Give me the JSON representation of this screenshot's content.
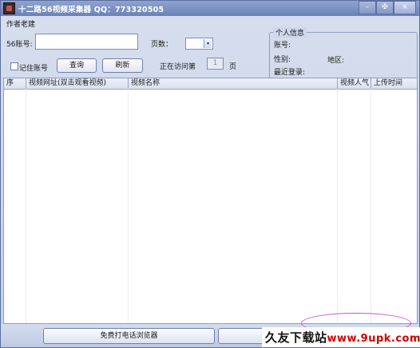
{
  "window": {
    "title": "十二路56视频采集器 QQ：773320505",
    "controls": [
      "–",
      "✠",
      "×"
    ]
  },
  "author_label": "作者老建",
  "form": {
    "account_label": "56账号:",
    "account_value": "",
    "pages_label": "页数：",
    "pages_value": "",
    "remember_label": "记住账号",
    "query_button": "查询",
    "refresh_button": "刷新",
    "visiting_label": "正在访问第",
    "visiting_page": "1",
    "page_unit": "页"
  },
  "personal_info": {
    "title": "个人信息",
    "account_label": "账号:",
    "gender_label": "性别:",
    "region_label": "地区:",
    "last_login_label": "最近登录:"
  },
  "table": {
    "columns": [
      "序",
      "视频网址(双击观看视频)",
      "视频名称",
      "视频人气",
      "上传时间"
    ],
    "rows": []
  },
  "bottom": {
    "phone_button": "免费打电话浏览器",
    "second_button": ""
  },
  "watermark": {
    "brand": "久友下载站",
    "url": "www.9upk.com"
  }
}
